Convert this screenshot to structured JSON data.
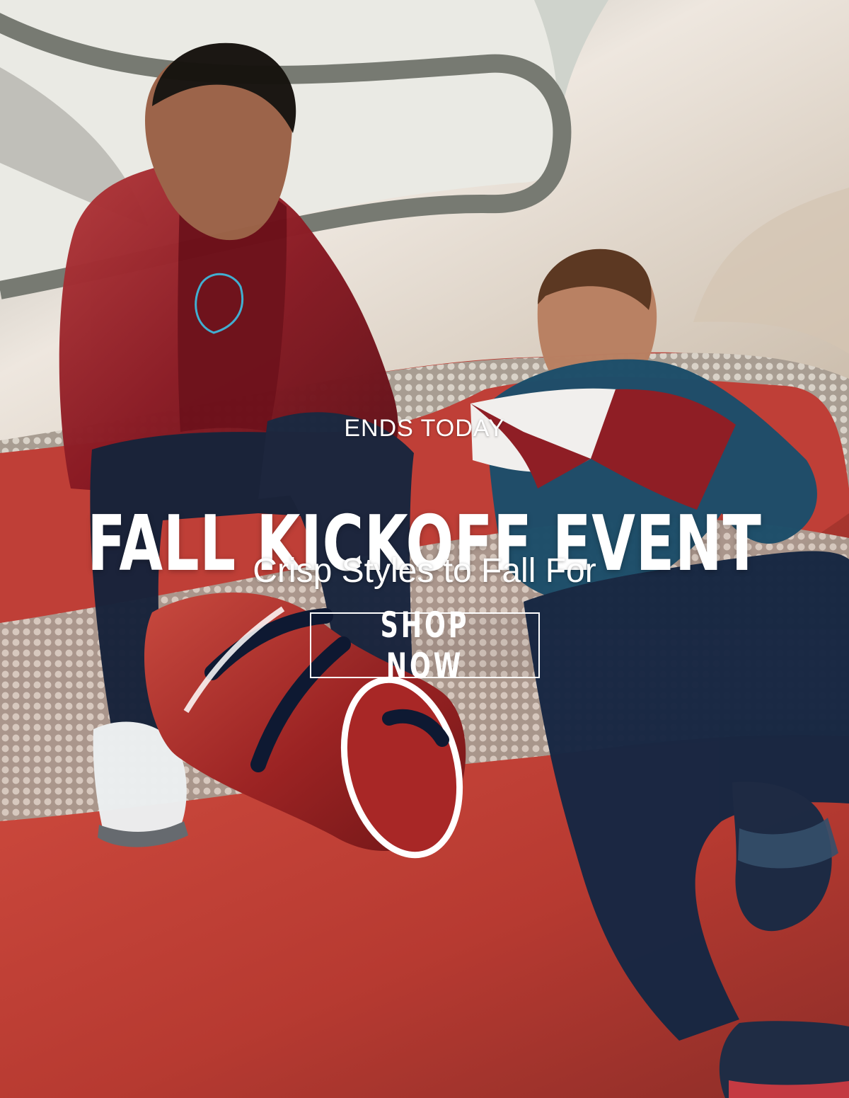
{
  "hero": {
    "eyebrow": "ENDS TODAY",
    "headline": "FALL KICKOFF EVENT",
    "subhead": "Crisp Styles to Fall For",
    "cta_label": "SHOP NOW"
  },
  "colors": {
    "text": "#ffffff",
    "floor_red": "#b93b32",
    "jacket_red": "#8f1e25",
    "navy": "#172742",
    "teal": "#1e506c",
    "ceiling": "#ddd5c8"
  }
}
